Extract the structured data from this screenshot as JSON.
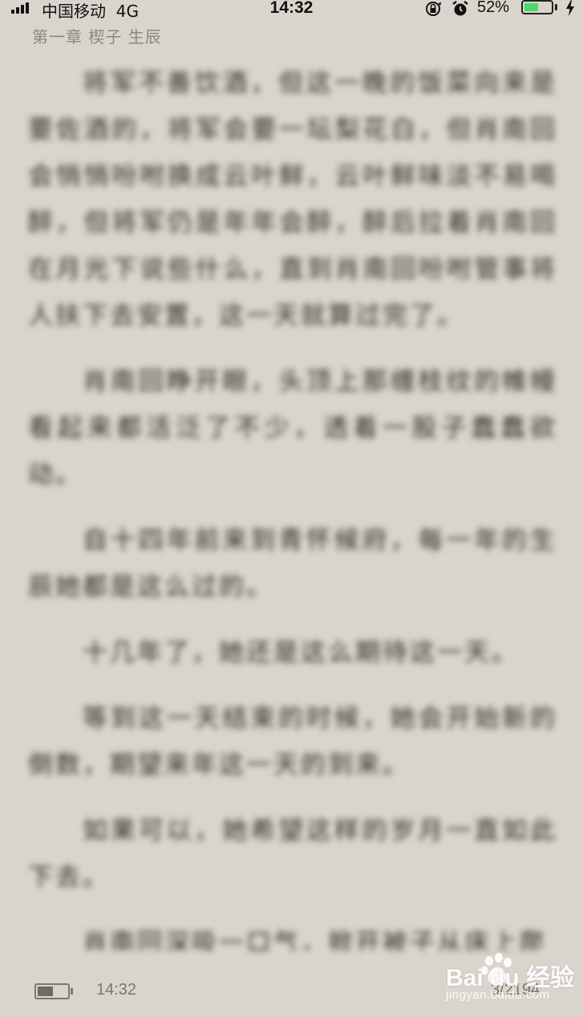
{
  "status_bar": {
    "carrier": "中国移动",
    "network": "4G",
    "time": "14:32",
    "battery_percent": "52%",
    "battery_level": 0.52,
    "icons": [
      "signal-bars-icon",
      "orientation-lock-icon",
      "alarm-icon",
      "battery-icon",
      "charging-bolt-icon"
    ],
    "battery_color": "#4cd964"
  },
  "chapter": {
    "title": "第一章 楔子 生辰"
  },
  "content": {
    "paragraphs": [
      "将军不善饮酒，但这一晚的饭菜向来是要佐酒的，将军会要一坛梨花白，但肖南回会悄悄吩咐换成云叶鲜，云叶鲜味淡不易喝醉，但将军仍是年年会醉，醉后拉着肖南回在月光下说些什么，直到肖南回吩咐管事将人扶下去安置，这一天就算过完了。",
      "肖南回睁开眼，头顶上那缠枝纹的帷幔看起来都活泛了不少，透着一股子蠢蠢欲动。",
      "自十四年前来到青怀候府，每一年的生辰她都是这么过的。",
      "十几年了，她还是这么期待这一天。",
      "等到这一天结束的时候，她会开始新的倒数，期望来年这一天的到来。",
      "如果可以，她希望这样的岁月一直如此下去。",
      "肖南回深吸一口气，掀开被子从床上爬"
    ]
  },
  "footer": {
    "time": "14:32",
    "page": "3/2194",
    "battery_level": 0.52
  },
  "watermark": {
    "brand": "Bai du 经验",
    "url": "jingyan.baidu.com"
  }
}
